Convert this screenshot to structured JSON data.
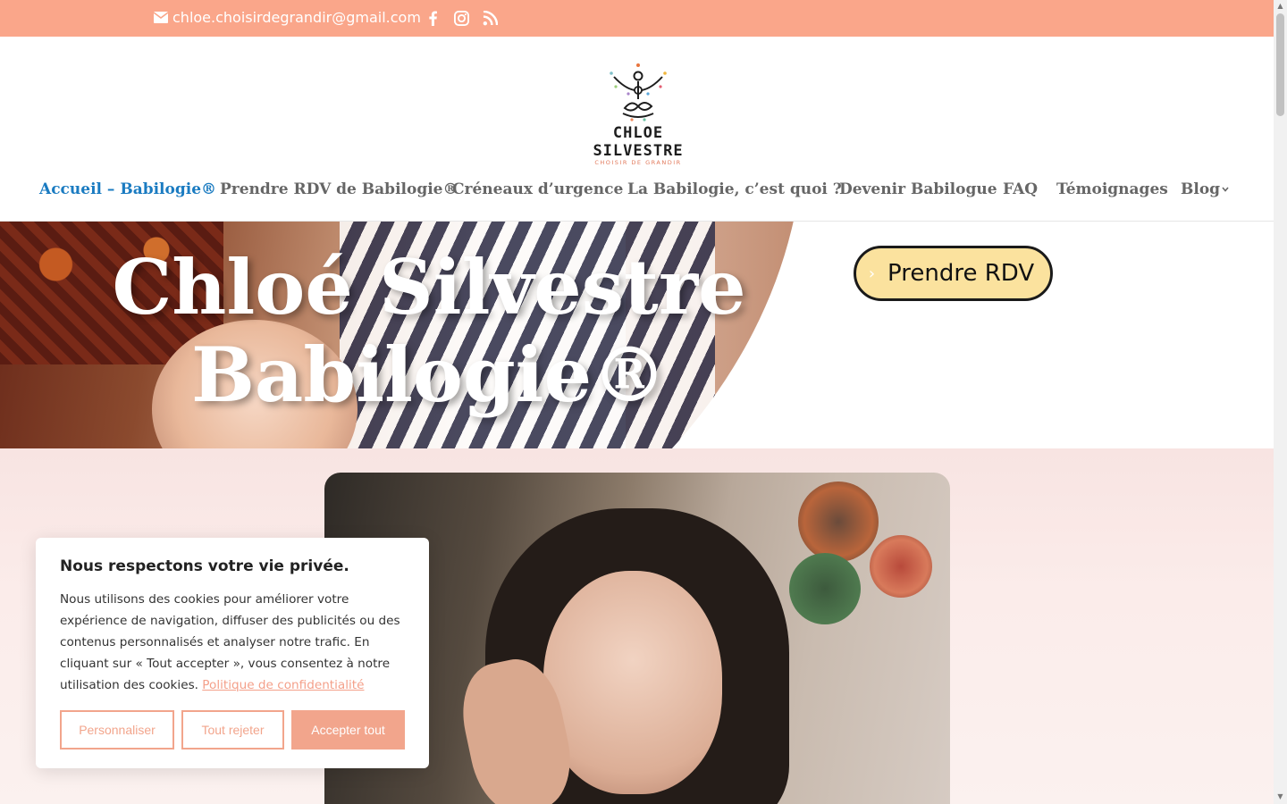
{
  "topbar": {
    "email": "chloe.choisirdegrandir@gmail.com",
    "social": [
      "facebook-icon",
      "instagram-icon",
      "rss-icon"
    ],
    "bg_color": "#faa68a"
  },
  "logo": {
    "title": "CHLOE SILVESTRE",
    "subtitle": "CHOISIR DE GRANDIR"
  },
  "nav": {
    "items": [
      {
        "label": "Accueil – Babilogie®",
        "active": true
      },
      {
        "label": "Prendre RDV de Babilogie®",
        "active": false
      },
      {
        "label": "Créneaux d’urgence",
        "active": false
      },
      {
        "label": "La Babilogie, c’est quoi ?",
        "active": false
      },
      {
        "label": "Devenir Babilogue",
        "active": false
      },
      {
        "label": "FAQ",
        "active": false
      },
      {
        "label": "Témoignages",
        "active": false
      },
      {
        "label": "Blog",
        "active": false,
        "has_dropdown": true
      }
    ],
    "active_color": "#1a7bc1"
  },
  "hero": {
    "title_line1": "Chloé Silvestre",
    "title_line2": "Babilogie®",
    "cta_label": "Prendre RDV",
    "cta_arrow": "›",
    "cta_color": "#fbe29e"
  },
  "cookie": {
    "title": "Nous respectons votre vie privée.",
    "body": "Nous utilisons des cookies  pour améliorer votre expérience de navigation, diffuser des publicités ou des contenus personnalisés et analyser notre trafic. En cliquant sur « Tout accepter », vous consentez à notre utilisation des cookies.",
    "link": "Politique de confidentialité",
    "btn_customize": "Personnaliser",
    "btn_reject": "Tout rejeter",
    "btn_accept": "Accepter tout",
    "accent_color": "#f2a58c"
  }
}
